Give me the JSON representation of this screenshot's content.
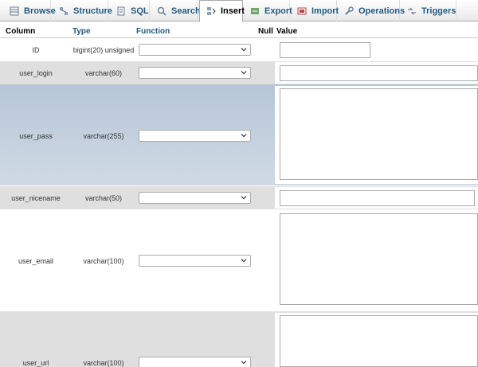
{
  "tabs": [
    {
      "label": "Browse",
      "icon": "browse-icon"
    },
    {
      "label": "Structure",
      "icon": "structure-icon"
    },
    {
      "label": "SQL",
      "icon": "sql-icon"
    },
    {
      "label": "Search",
      "icon": "search-icon"
    },
    {
      "label": "Insert",
      "icon": "insert-icon",
      "active": true
    },
    {
      "label": "Export",
      "icon": "export-icon"
    },
    {
      "label": "Import",
      "icon": "import-icon"
    },
    {
      "label": "Operations",
      "icon": "operations-icon"
    },
    {
      "label": "Triggers",
      "icon": "triggers-icon"
    }
  ],
  "headers": {
    "column": "Column",
    "type": "Type",
    "function": "Function",
    "null": "Null",
    "value": "Value"
  },
  "rows": [
    {
      "column": "ID",
      "type": "bigint(20) unsigned",
      "function": "",
      "value": ""
    },
    {
      "column": "user_login",
      "type": "varchar(60)",
      "function": "",
      "value": ""
    },
    {
      "column": "user_pass",
      "type": "varchar(255)",
      "function": "",
      "value": ""
    },
    {
      "column": "user_nicename",
      "type": "varchar(50)",
      "function": "",
      "value": ""
    },
    {
      "column": "user_email",
      "type": "varchar(100)",
      "function": "",
      "value": ""
    },
    {
      "column": "user_url",
      "type": "varchar(100)",
      "function": "",
      "value": ""
    }
  ],
  "colors": {
    "link": "#235a81",
    "highlight_row": "#c2cfdd",
    "even_row": "#dfdfdf"
  }
}
